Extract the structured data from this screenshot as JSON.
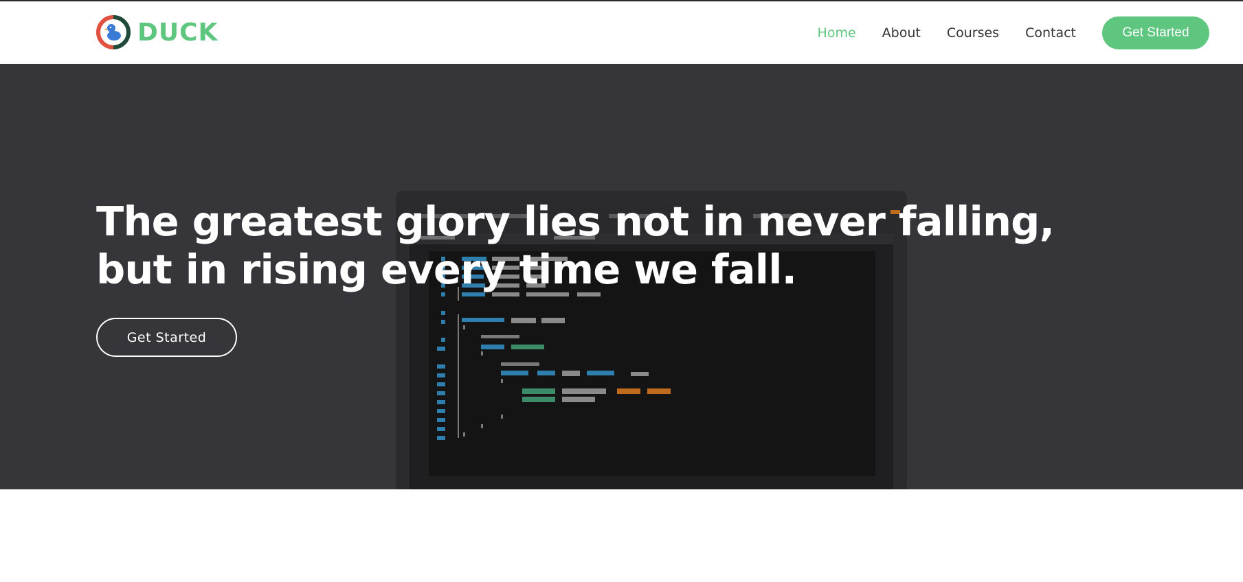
{
  "brand": {
    "name": "DUCK",
    "logo_icon": "duck-icon",
    "accent_color": "#5ec67f"
  },
  "nav": {
    "items": [
      {
        "label": "Home",
        "active": true
      },
      {
        "label": "About",
        "active": false
      },
      {
        "label": "Courses",
        "active": false
      },
      {
        "label": "Contact",
        "active": false
      }
    ],
    "cta_label": "Get Started"
  },
  "hero": {
    "title": "The greatest glory lies not in never falling, but in rising every time we fall.",
    "button_label": "Get Started",
    "background_color": "#36353a"
  }
}
